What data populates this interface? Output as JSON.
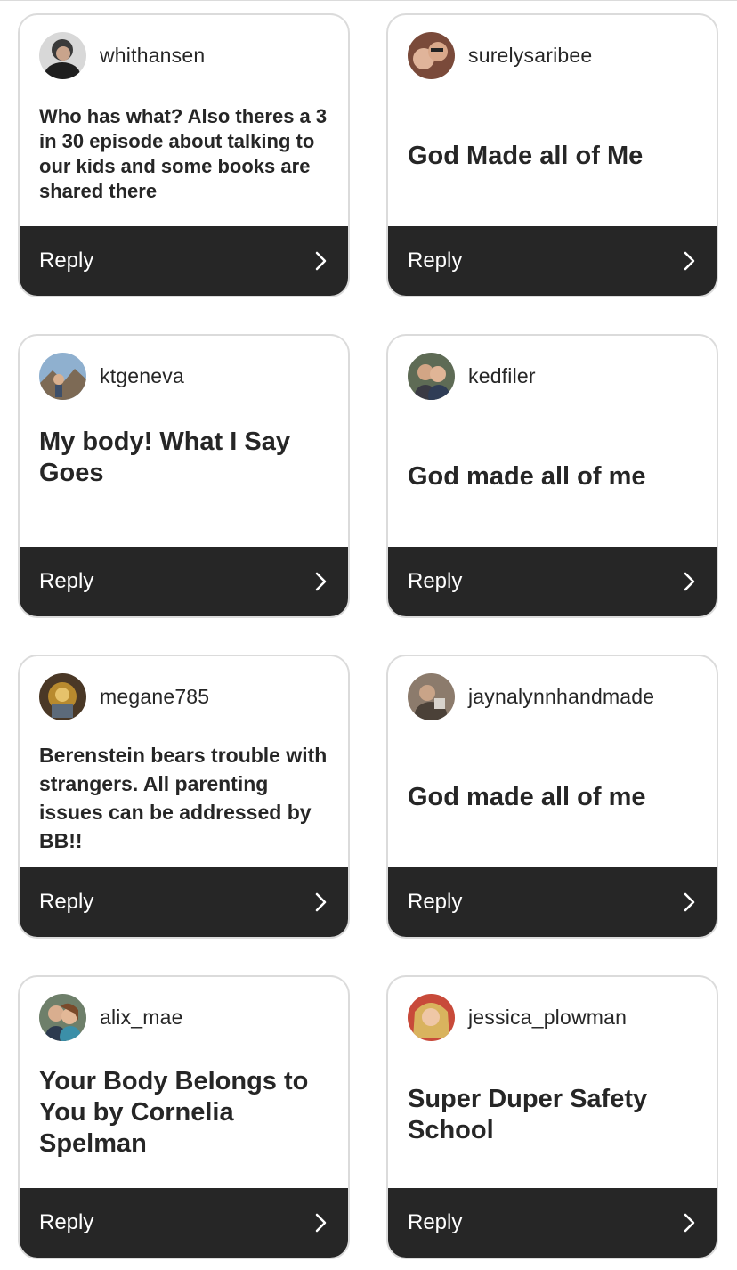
{
  "reply_label": "Reply",
  "colors": {
    "bar": "#262626",
    "border": "#dbdbdb",
    "text": "#262626"
  },
  "cards": [
    {
      "username": "whithansen",
      "text": "Who has what? Also theres a 3 in 30 episode about talking to our kids and some books are shared there",
      "avatar_icon": "profile-photo"
    },
    {
      "username": "surelysaribee",
      "text": "God Made all of Me",
      "avatar_icon": "profile-photo"
    },
    {
      "username": "ktgeneva",
      "text": "My body! What I Say Goes",
      "avatar_icon": "profile-photo"
    },
    {
      "username": "kedfiler",
      "text": "God made all of me",
      "avatar_icon": "profile-photo"
    },
    {
      "username": "megane785",
      "text": "Berenstein bears trouble with strangers. All parenting issues can be addressed by BB!!",
      "avatar_icon": "profile-photo"
    },
    {
      "username": "jaynalynnhandmade",
      "text": "God made all of me",
      "avatar_icon": "profile-photo"
    },
    {
      "username": "alix_mae",
      "text": "Your Body Belongs to You by Cornelia Spelman",
      "avatar_icon": "profile-photo"
    },
    {
      "username": "jessica_plowman",
      "text": "Super Duper Safety School",
      "avatar_icon": "profile-photo"
    }
  ]
}
